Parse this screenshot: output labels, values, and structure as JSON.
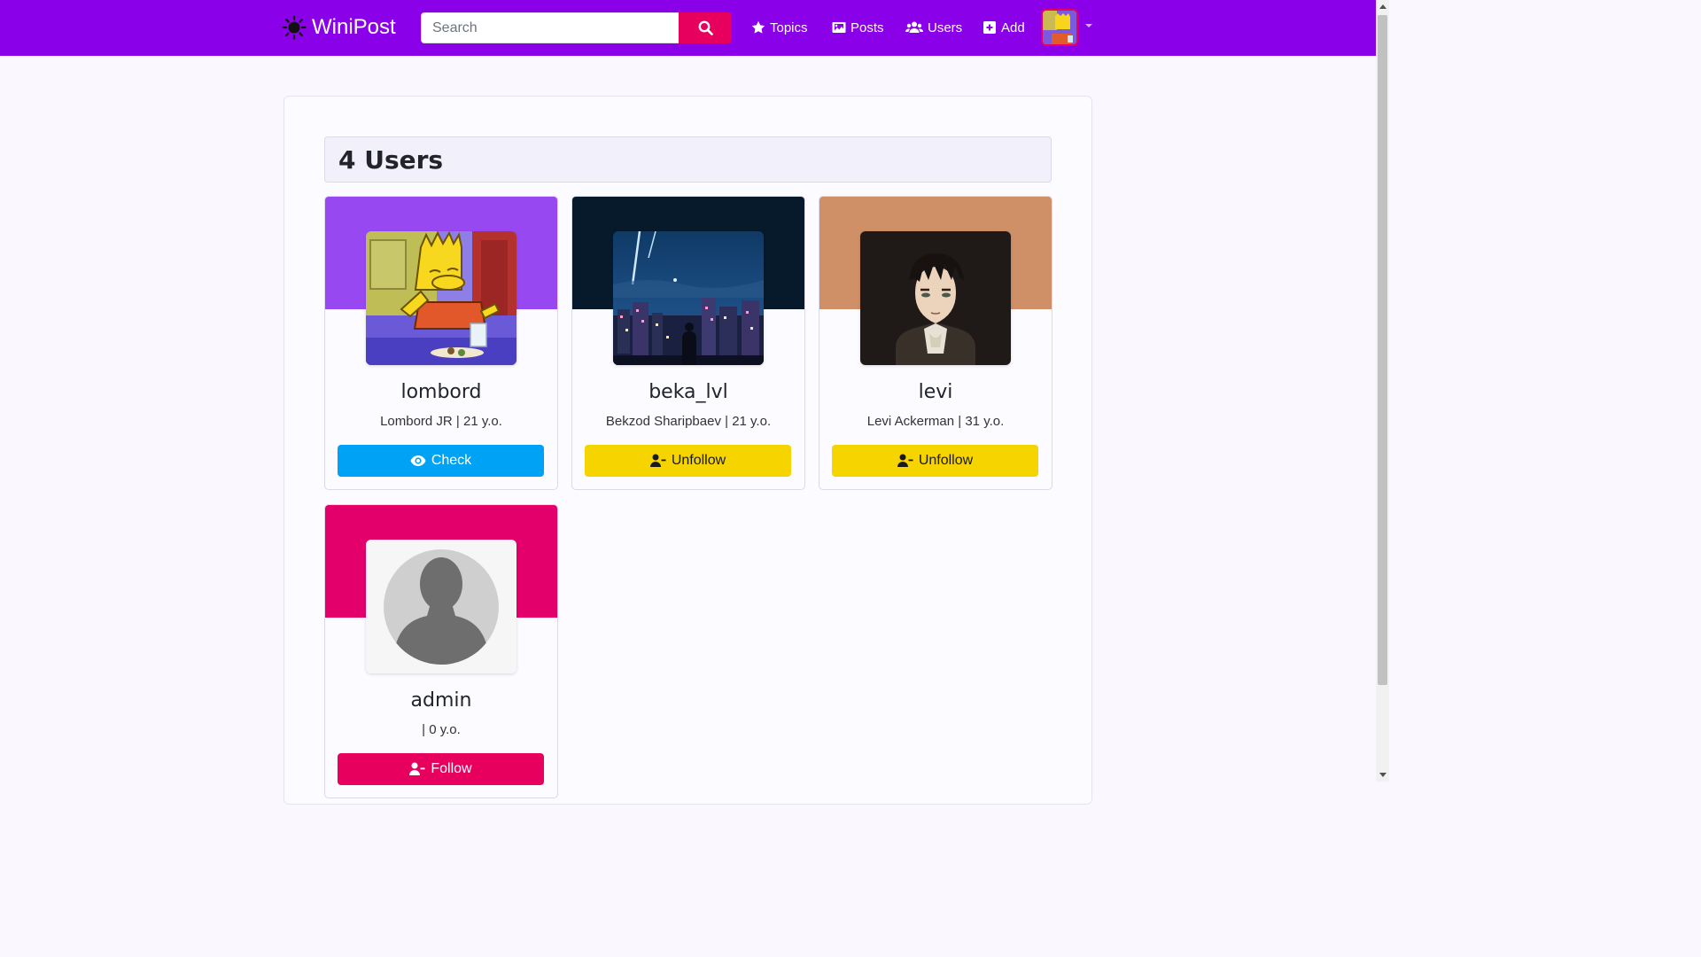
{
  "navbar": {
    "brand": "WiniPost",
    "search_placeholder": "Search",
    "links": [
      {
        "label": "Topics",
        "icon": "star-icon"
      },
      {
        "label": "Posts",
        "icon": "image-icon"
      },
      {
        "label": "Users",
        "icon": "users-icon"
      },
      {
        "label": "Add",
        "icon": "plus-square-icon"
      }
    ],
    "color": "#8a00e8",
    "accent": "#e8005f"
  },
  "page": {
    "heading": "4 Users"
  },
  "users": [
    {
      "username": "lombord",
      "subtitle": "Lombord JR | 21 y.o.",
      "button": "Check",
      "button_icon": "eye-icon",
      "banner_color": "#9848f0"
    },
    {
      "username": "beka_lvl",
      "subtitle": "Bekzod Sharipbaev | 21 y.o.",
      "button": "Unfollow",
      "button_icon": "user-minus-icon",
      "banner_color": "#061a2c"
    },
    {
      "username": "levi",
      "subtitle": "Levi Ackerman | 31 y.o.",
      "button": "Unfollow",
      "button_icon": "user-minus-icon",
      "banner_color": "#cf9068"
    },
    {
      "username": "admin",
      "subtitle": "| 0 y.o.",
      "button": "Follow",
      "button_icon": "user-minus-icon",
      "banner_color": "#e4006a"
    }
  ]
}
